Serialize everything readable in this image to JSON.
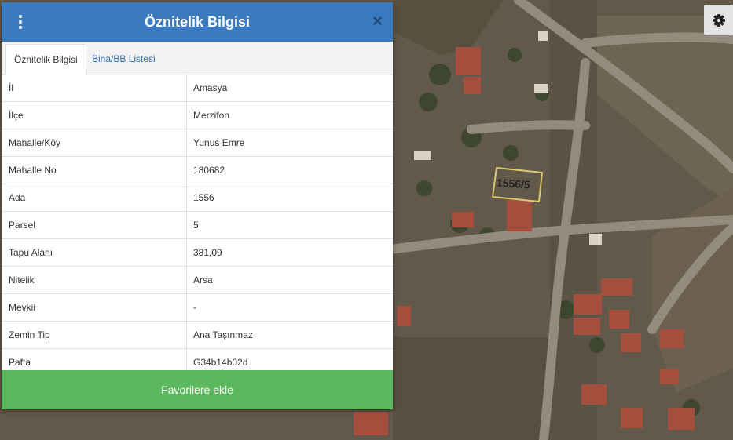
{
  "panel": {
    "title": "Öznitelik Bilgisi",
    "close_icon": "×",
    "tabs": [
      {
        "label": "Öznitelik Bilgisi",
        "active": true
      },
      {
        "label": "Bina/BB Listesi",
        "active": false
      }
    ],
    "rows": [
      {
        "key": "İl",
        "value": "Amasya"
      },
      {
        "key": "İlçe",
        "value": "Merzifon"
      },
      {
        "key": "Mahalle/Köy",
        "value": "Yunus Emre"
      },
      {
        "key": "Mahalle No",
        "value": "180682"
      },
      {
        "key": "Ada",
        "value": "1556"
      },
      {
        "key": "Parsel",
        "value": "5"
      },
      {
        "key": "Tapu Alanı",
        "value": "381,09"
      },
      {
        "key": "Nitelik",
        "value": "Arsa"
      },
      {
        "key": "Mevkii",
        "value": "-"
      },
      {
        "key": "Zemin Tip",
        "value": "Ana Taşınmaz"
      },
      {
        "key": "Pafta",
        "value": "G34b14b02d"
      }
    ],
    "favorite_button": "Favorilere ekle"
  },
  "map": {
    "parcel_label": "1556/5",
    "settings_icon": "gear-icon"
  },
  "colors": {
    "header": "#3a7bbf",
    "favorite_button": "#5cb85c",
    "tab_link": "#2f6fb0",
    "parcel_outline": "#d8c96a"
  }
}
